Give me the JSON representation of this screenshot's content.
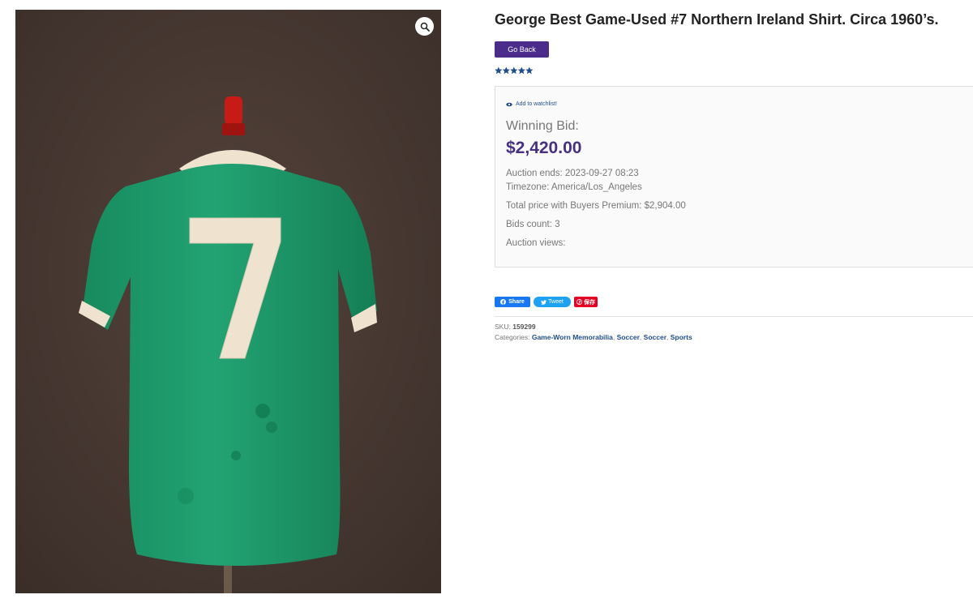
{
  "product": {
    "title": "George Best Game-Used #7 Northern Ireland Shirt. Circa 1960’s.",
    "image": {
      "shirt_number": "7",
      "colors": {
        "backdrop": "#4a3a33",
        "shirt": "#1f9a6b",
        "trim": "#efe3cf",
        "stand_top": "#c91b16"
      }
    },
    "rating": {
      "stars": 5,
      "max": 5,
      "color": "#1f4e8c"
    }
  },
  "actions": {
    "go_back_label": "Go Back",
    "watchlist_label": "Add to watchlist!"
  },
  "auction": {
    "winning_bid_label": "Winning Bid:",
    "winning_bid_value": "$2,420.00",
    "ends": "Auction ends: 2023-09-27 08:23",
    "timezone": "Timezone: America/Los_Angeles",
    "total_price": "Total price with Buyers Premium: $2,904.00",
    "bids_count": "Bids count: 3",
    "views": "Auction views:"
  },
  "share": {
    "facebook_label": "Share",
    "twitter_label": "Tweet",
    "pinterest_label": "保存"
  },
  "meta": {
    "sku_label": "SKU:",
    "sku_value": "159299",
    "categories_label": "Categories:",
    "categories": [
      "Game-Worn Memorabilia",
      "Soccer",
      "Soccer",
      "Sports"
    ]
  },
  "theme": {
    "accent": "#4b2c8a",
    "price_color": "#46307f",
    "link_color": "#1f4e8c"
  }
}
